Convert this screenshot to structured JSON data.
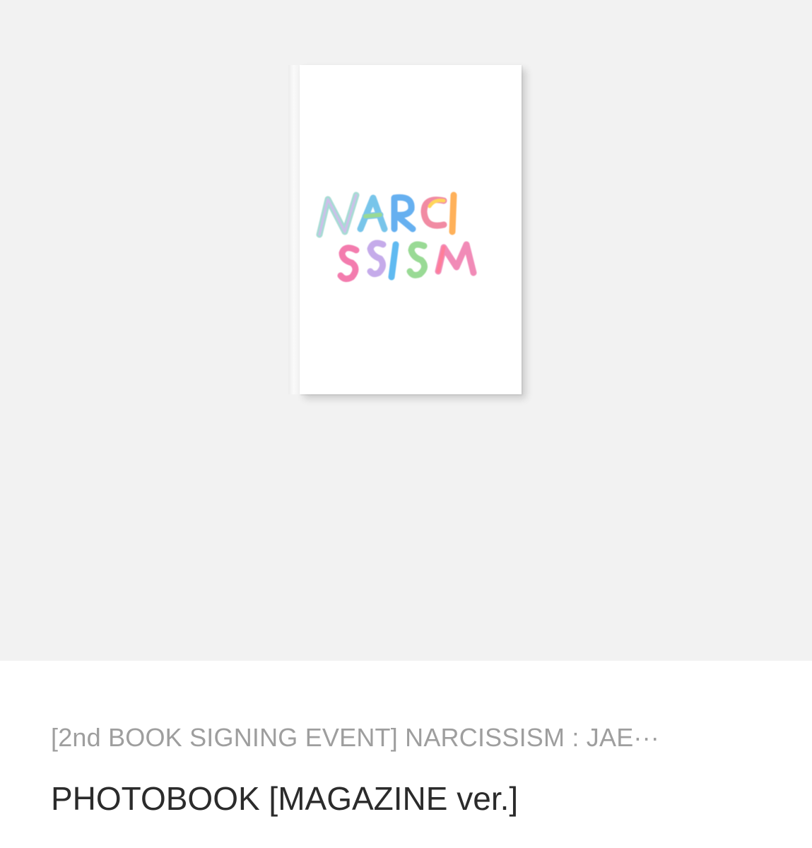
{
  "product": {
    "image": {
      "cover_text_line1": "NARCI",
      "cover_text_line2": "SSISM"
    },
    "title_line1": "[2nd BOOK SIGNING EVENT] NARCISSISM : JAE···",
    "title_line2": "PHOTOBOOK [MAGAZINE ver.]"
  },
  "colors": {
    "hero_background": "#f2f2f2",
    "title_primary": "#2b2b2b",
    "title_secondary": "#9e9e9e"
  }
}
